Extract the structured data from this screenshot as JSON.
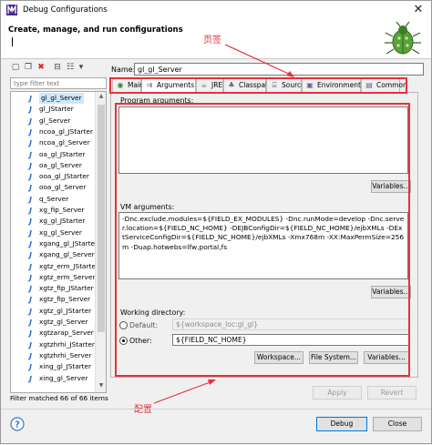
{
  "window": {
    "title": "Debug Configurations"
  },
  "header": {
    "title": "Create, manage, and run configurations"
  },
  "annotations": {
    "tabs_note": "页签",
    "config_note": "配置"
  },
  "left": {
    "filter_placeholder": "type filter text",
    "items": [
      "gl_gl_Server",
      "gl_JStarter",
      "gl_Server",
      "ncoa_gl_JStarter",
      "ncoa_gl_Server",
      "oa_gl_JStarter",
      "oa_gl_Server",
      "ooa_gl_JStarter",
      "ooa_gl_Server",
      "q_Server",
      "xg_fip_Server",
      "xg_gl_JStarter",
      "xg_gl_Server",
      "xgang_gl_JStarter",
      "xgang_gl_Server",
      "xgtz_erm_JStarter",
      "xgtz_erm_Server",
      "xgtz_fip_JStarter",
      "xgtz_fip_Server",
      "xgtz_gl_JStarter",
      "xgtz_gl_Server",
      "xgtzarap_Server",
      "xgtzhrhi_JStarter",
      "xgtzhrhi_Server",
      "xing_gl_JStarter",
      "xing_gl_Server"
    ],
    "selected_index": 0,
    "status": "Filter matched 66 of 66 items"
  },
  "config": {
    "name_label": "Name:",
    "name_value": "gl_gl_Server",
    "tabs": [
      {
        "label": "Main",
        "icon": "main-tab-icon"
      },
      {
        "label": "Arguments",
        "icon": "arguments-tab-icon"
      },
      {
        "label": "JRE",
        "icon": "jre-tab-icon"
      },
      {
        "label": "Classpath",
        "icon": "classpath-tab-icon"
      },
      {
        "label": "Source",
        "icon": "source-tab-icon"
      },
      {
        "label": "Environment",
        "icon": "environment-tab-icon"
      },
      {
        "label": "Common",
        "icon": "common-tab-icon"
      }
    ],
    "active_tab": 1,
    "program_args_label": "Program arguments:",
    "program_args_value": "",
    "variables_label": "Variables...",
    "vm_args_label": "VM arguments:",
    "vm_args_value": "-Dnc.exclude.modules=${FIELD_EX_MODULES} -Dnc.runMode=develop -Dnc.server.location=${FIELD_NC_HOME} -DEJBConfigDir=${FIELD_NC_HOME}/ejbXMLs -DExtServiceConfigDir=${FIELD_NC_HOME}/ejbXMLs -Xmx768m -XX:MaxPermSize=256m -Duap.hotwebs=lfw,portal,fs",
    "working_dir_label": "Working directory:",
    "default_label": "Default:",
    "default_value": "${workspace_loc:gl_gl}",
    "other_label": "Other:",
    "other_value": "${FIELD_NC_HOME}",
    "workspace_btn": "Workspace...",
    "filesystem_btn": "File System...",
    "wd_variables_btn": "Variables..."
  },
  "buttons": {
    "apply": "Apply",
    "revert": "Revert",
    "debug": "Debug",
    "close": "Close"
  },
  "colors": {
    "accent": "#0078d7",
    "annotation": "#e8303a",
    "java_icon": "#2b6bc9"
  }
}
